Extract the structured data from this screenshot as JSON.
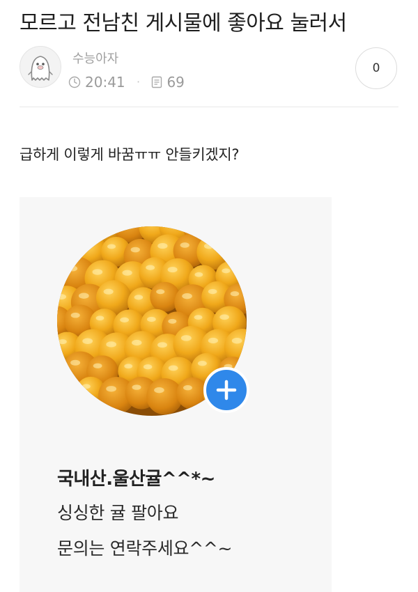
{
  "post": {
    "title": "모르고 전남친 게시물에 좋아요 눌러서",
    "body": "급하게 이렇게 바꿈ㅠㅠ 안들키겠지?"
  },
  "author": {
    "name": "수능아자",
    "time": "20:41",
    "views": "69",
    "avatar_icon": "ghost-avatar-icon"
  },
  "like": {
    "count": "0"
  },
  "screenshot": {
    "profile_name": "국내산.울산귤^^*~",
    "line1": "싱싱한 귤 팔아요",
    "line2": "문의는 연락주세요^^~",
    "add_icon": "plus-icon",
    "add_color": "#2f88ea"
  }
}
